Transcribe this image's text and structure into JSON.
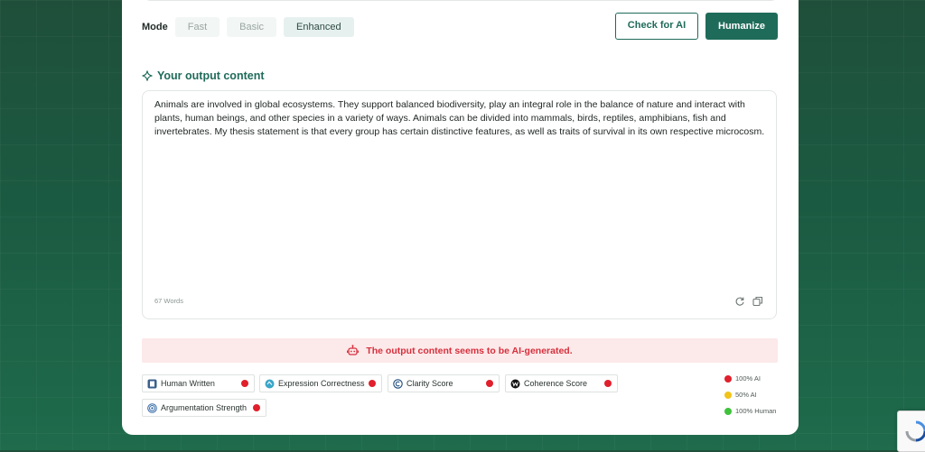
{
  "mode": {
    "label": "Mode",
    "options": [
      "Fast",
      "Basic",
      "Enhanced"
    ],
    "selected": "Enhanced"
  },
  "actions": {
    "check_label": "Check for AI",
    "humanize_label": "Humanize"
  },
  "output": {
    "title": "Your output content",
    "text": "Animals are involved in global ecosystems. They support balanced biodiversity, play an integral role in the balance of nature and interact with plants, human beings, and other species in a variety of ways. Animals can be divided into mammals, birds, reptiles, amphibians, fish and invertebrates. My thesis statement is that every group has certain distinctive features, as well as traits of survival in its own respective microcosm.",
    "word_count": "67 Words"
  },
  "alert": {
    "text": "The output content seems to be AI-generated.",
    "color": "#d6303c"
  },
  "metrics": [
    {
      "label": "Human Written",
      "icon": "human-written-icon",
      "status": "ai"
    },
    {
      "label": "Expression Correctness",
      "icon": "expression-icon",
      "status": "ai"
    },
    {
      "label": "Clarity Score",
      "icon": "clarity-icon",
      "status": "ai"
    },
    {
      "label": "Coherence Score",
      "icon": "coherence-icon",
      "status": "ai"
    },
    {
      "label": "Argumentation Strength",
      "icon": "argumentation-icon",
      "status": "ai"
    }
  ],
  "legend": [
    {
      "label": "100% AI",
      "color": "#e0202c"
    },
    {
      "label": "50% AI",
      "color": "#f2c318"
    },
    {
      "label": "100% Human",
      "color": "#3fc23c"
    }
  ],
  "colors": {
    "accent": "#1f6b5a",
    "background": "#1b5a42"
  }
}
